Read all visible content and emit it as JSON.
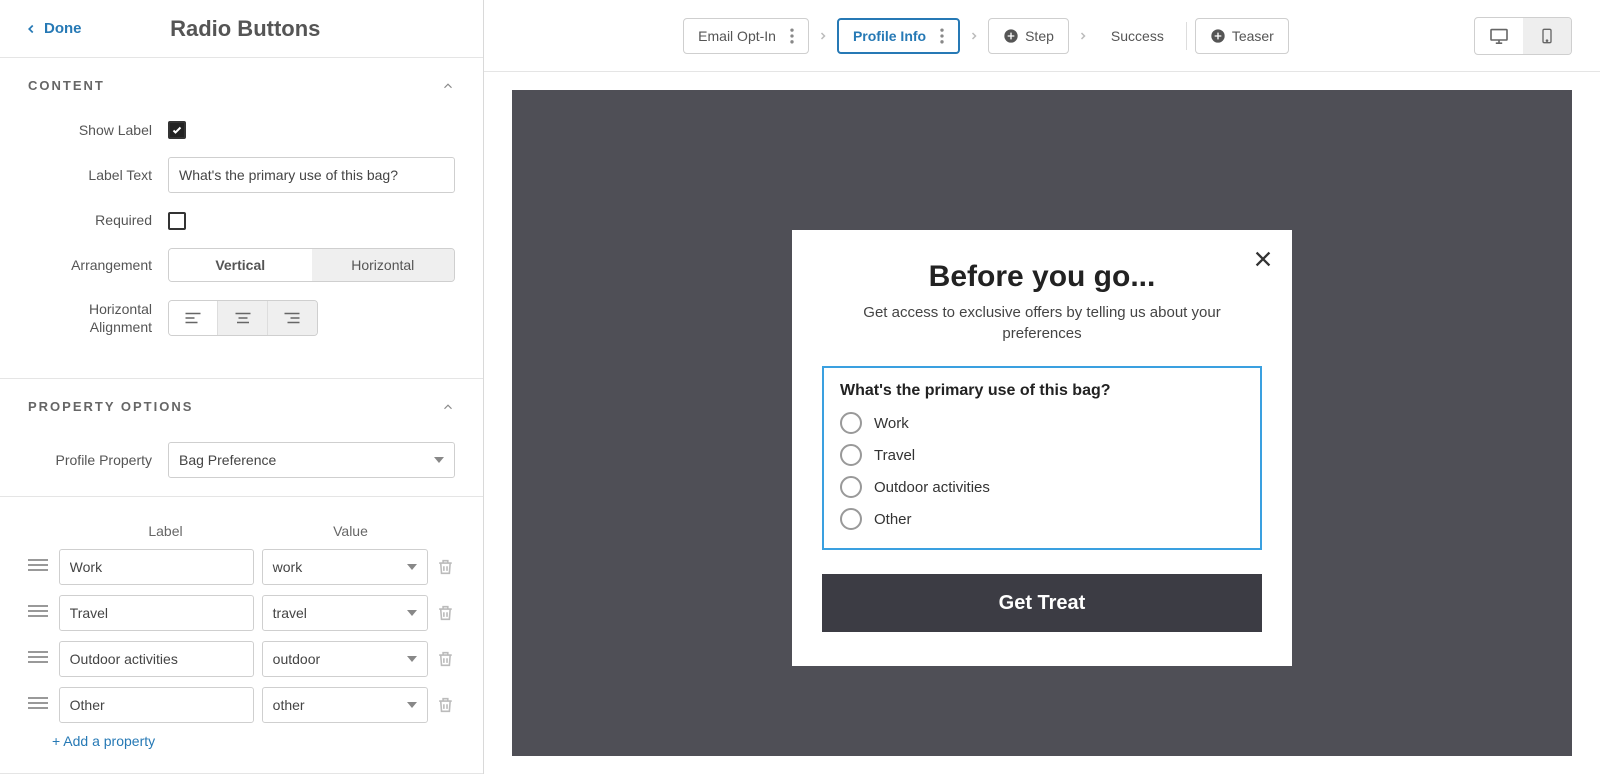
{
  "header": {
    "back": "Done",
    "title": "Radio Buttons"
  },
  "contentPanel": {
    "title": "Content",
    "showLabel": "Show Label",
    "showLabelChecked": true,
    "labelText": "Label Text",
    "labelTextValue": "What's the primary use of this bag?",
    "required": "Required",
    "requiredChecked": false,
    "arrangement": "Arrangement",
    "arrangementOptions": {
      "vertical": "Vertical",
      "horizontal": "Horizontal"
    },
    "arrangementActive": "vertical",
    "hAlign": "Horizontal Alignment"
  },
  "propertyPanel": {
    "title": "Property Options",
    "profileProperty": "Profile Property",
    "profilePropertyValue": "Bag Preference",
    "colLabel": "Label",
    "colValue": "Value",
    "options": [
      {
        "label": "Work",
        "value": "work"
      },
      {
        "label": "Travel",
        "value": "travel"
      },
      {
        "label": "Outdoor activities",
        "value": "outdoor"
      },
      {
        "label": "Other",
        "value": "other"
      }
    ],
    "addProperty": "+ Add a property"
  },
  "topbar": {
    "steps": {
      "emailOptIn": "Email Opt-In",
      "profileInfo": "Profile Info",
      "step": "Step",
      "success": "Success",
      "teaser": "Teaser"
    }
  },
  "preview": {
    "title": "Before you go...",
    "subtitle": "Get access to exclusive offers by telling us about your preferences",
    "question": "What's the primary use of this bag?",
    "options": [
      "Work",
      "Travel",
      "Outdoor activities",
      "Other"
    ],
    "cta": "Get Treat"
  }
}
